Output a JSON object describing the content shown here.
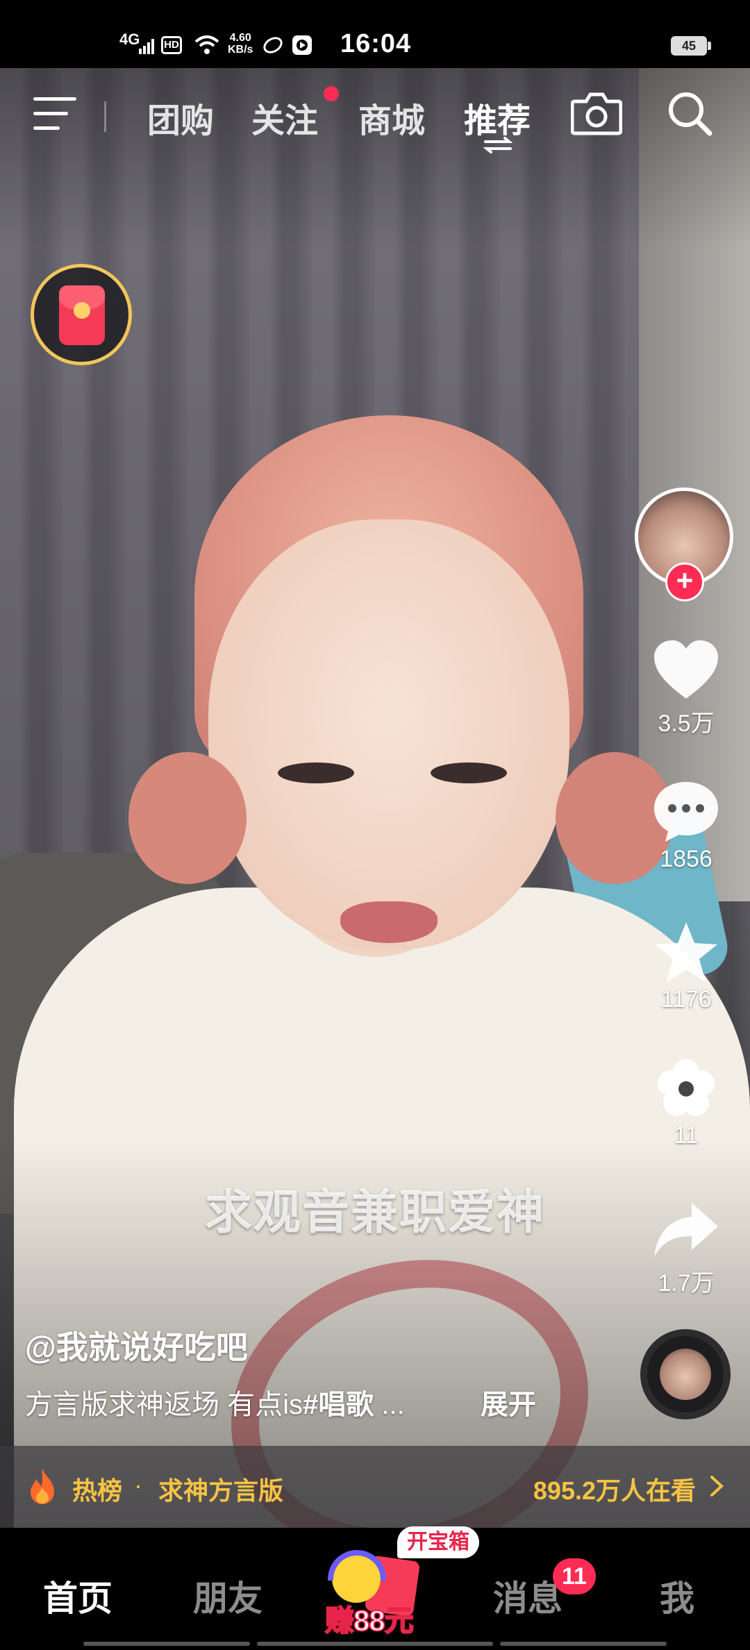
{
  "status_bar": {
    "network": "4G",
    "hd": "HD",
    "speed_value": "4.60",
    "speed_unit": "KB/s",
    "time": "16:04",
    "battery": "45"
  },
  "top_nav": {
    "tabs": [
      {
        "label": "团购"
      },
      {
        "label": "关注"
      },
      {
        "label": "商城"
      },
      {
        "label": "推荐"
      }
    ],
    "active_tab": "推荐"
  },
  "actions": {
    "likes": "3.5万",
    "comments": "1856",
    "favorites": "1176",
    "flowers": "11",
    "shares": "1.7万"
  },
  "video": {
    "subtitle": "求观音兼职爱神",
    "author": "@我就说好吃吧",
    "description_text": "方言版求神返场 有点is",
    "description_tag": "#唱歌",
    "description_ellipsis": " ...",
    "expand_label": "展开"
  },
  "hot_bar": {
    "label": "热榜",
    "separator": "·",
    "topic": "求神方言版",
    "viewers": "895.2万人在看"
  },
  "bottom_tabs": {
    "home": "首页",
    "friends": "朋友",
    "earn": "赚88元",
    "treasure": "开宝箱",
    "messages": "消息",
    "messages_badge": "11",
    "me": "我"
  },
  "colors": {
    "accent_red": "#fe2c55",
    "hot_yellow": "#f6c343"
  },
  "icons": [
    "menu-icon",
    "camera-icon",
    "search-icon",
    "heart-icon",
    "comment-icon",
    "star-icon",
    "flower-icon",
    "share-icon",
    "fire-icon",
    "chevron-right-icon",
    "switch-arrows-icon"
  ]
}
